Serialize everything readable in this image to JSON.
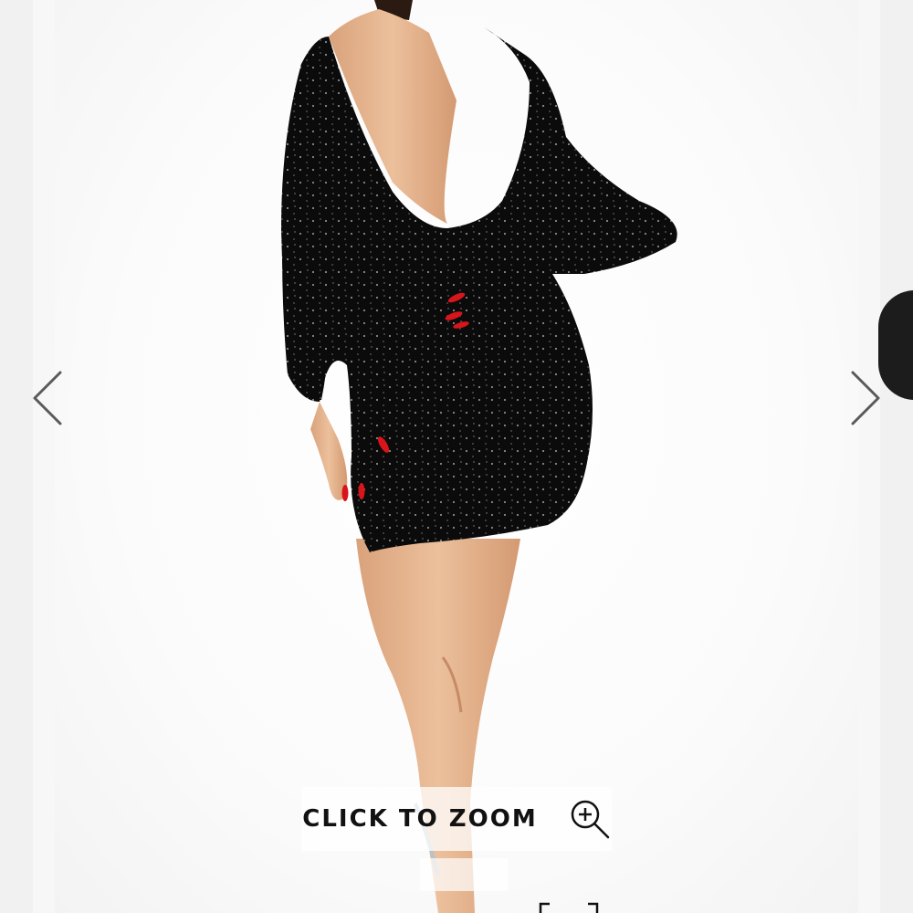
{
  "gallery": {
    "zoom_label": "CLICK TO ZOOM",
    "icons": {
      "prev": "chevron-left-icon",
      "next": "chevron-right-icon",
      "zoom": "zoom-in-icon",
      "fullscreen": "fullscreen-icon"
    },
    "colors": {
      "dress": "#0b0b0b",
      "skin": "#e2b08a",
      "nails": "#d8151b",
      "arrow": "#5a5a5a"
    }
  }
}
